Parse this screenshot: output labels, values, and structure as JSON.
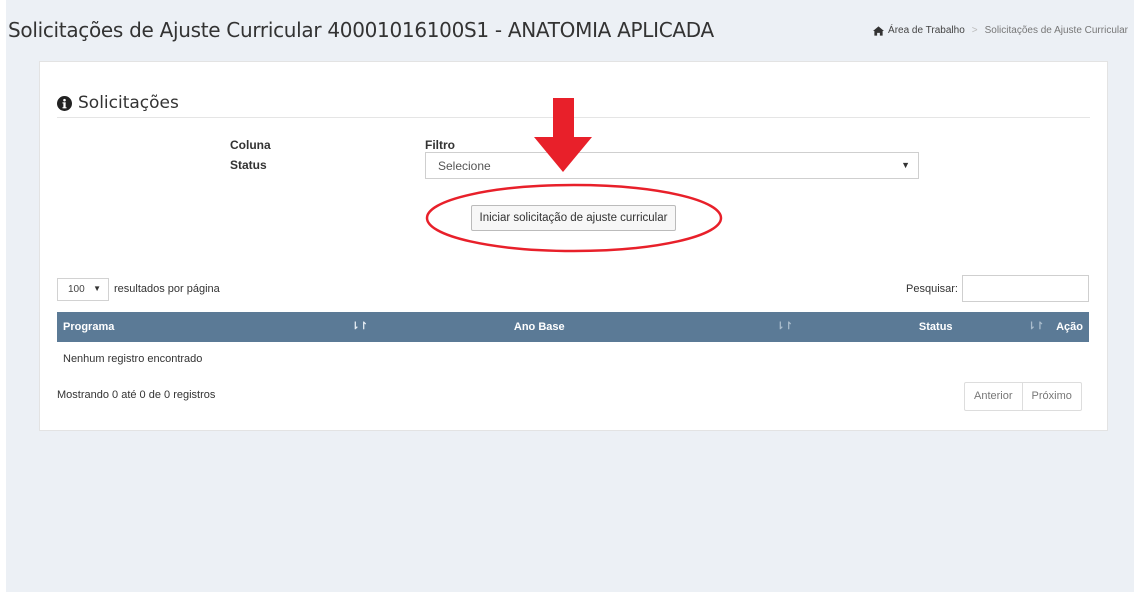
{
  "header": {
    "title": "Solicitações de Ajuste Curricular 40001016100S1 - ANATOMIA APLICADA",
    "breadcrumb": {
      "home_icon": "home-icon",
      "home": "Área de Trabalho",
      "current": "Solicitações de Ajuste Curricular"
    }
  },
  "panel": {
    "title": "Solicitações",
    "title_icon": "info-circle-icon",
    "filter": {
      "column_header": "Coluna",
      "filter_header": "Filtro",
      "row_label": "Status",
      "select_value": "Selecione"
    },
    "start_button": "Iniciar solicitação de ajuste curricular",
    "annotation_color": "#e8202a"
  },
  "table_controls": {
    "page_length": "100",
    "page_length_label": "resultados por página",
    "search_label": "Pesquisar:",
    "search_value": ""
  },
  "table": {
    "columns": [
      {
        "label": "Programa",
        "sort": "sorted-asc"
      },
      {
        "label": "Ano Base",
        "sort": "sortable"
      },
      {
        "label": "Status",
        "sort": "sortable"
      },
      {
        "label": "Ação",
        "sort": "none"
      }
    ],
    "empty_message": "Nenhum registro encontrado",
    "header_color": "#5b7a96"
  },
  "footer": {
    "info": "Mostrando 0 até 0 de 0 registros",
    "prev": "Anterior",
    "next": "Próximo"
  }
}
